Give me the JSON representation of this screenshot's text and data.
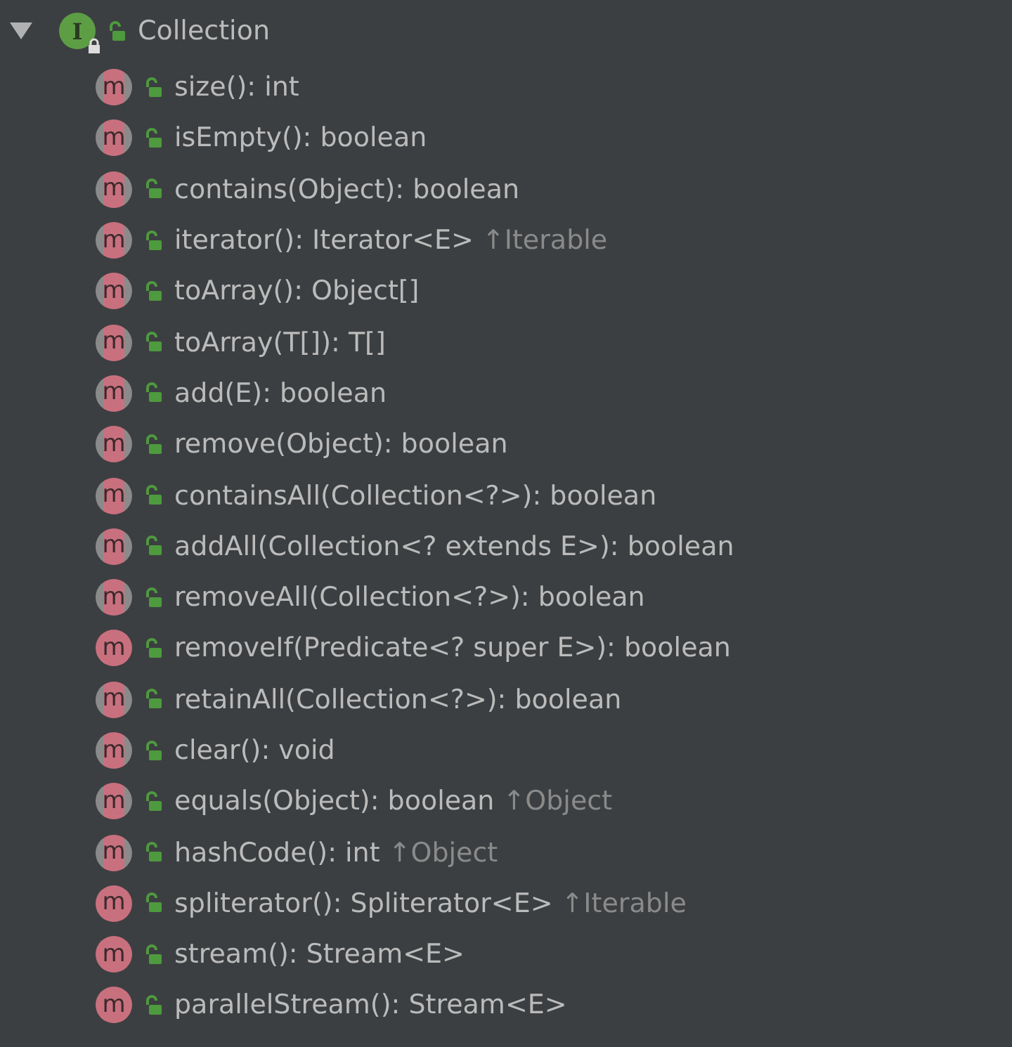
{
  "tree": {
    "label": "Collection",
    "icon": "I",
    "expanded": true,
    "children": [
      {
        "label": "size(): int",
        "icon": "m",
        "kind": "abstract"
      },
      {
        "label": "isEmpty(): boolean",
        "icon": "m",
        "kind": "abstract"
      },
      {
        "label": "contains(Object): boolean",
        "icon": "m",
        "kind": "abstract"
      },
      {
        "label": "iterator(): Iterator<E>",
        "origin": "↑Iterable",
        "icon": "m",
        "kind": "abstract"
      },
      {
        "label": "toArray(): Object[]",
        "icon": "m",
        "kind": "abstract"
      },
      {
        "label": "toArray(T[]): T[]",
        "icon": "m",
        "kind": "abstract"
      },
      {
        "label": "add(E): boolean",
        "icon": "m",
        "kind": "abstract"
      },
      {
        "label": "remove(Object): boolean",
        "icon": "m",
        "kind": "abstract"
      },
      {
        "label": "containsAll(Collection<?>): boolean",
        "icon": "m",
        "kind": "abstract"
      },
      {
        "label": "addAll(Collection<? extends E>): boolean",
        "icon": "m",
        "kind": "abstract"
      },
      {
        "label": "removeAll(Collection<?>): boolean",
        "icon": "m",
        "kind": "abstract"
      },
      {
        "label": "removeIf(Predicate<? super E>): boolean",
        "icon": "m",
        "kind": "default"
      },
      {
        "label": "retainAll(Collection<?>): boolean",
        "icon": "m",
        "kind": "abstract"
      },
      {
        "label": "clear(): void",
        "icon": "m",
        "kind": "abstract"
      },
      {
        "label": "equals(Object): boolean",
        "origin": "↑Object",
        "icon": "m",
        "kind": "abstract"
      },
      {
        "label": "hashCode(): int",
        "origin": "↑Object",
        "icon": "m",
        "kind": "abstract"
      },
      {
        "label": "spliterator(): Spliterator<E>",
        "origin": "↑Iterable",
        "icon": "m",
        "kind": "default"
      },
      {
        "label": "stream(): Stream<E>",
        "icon": "m",
        "kind": "default"
      },
      {
        "label": "parallelStream(): Stream<E>",
        "icon": "m",
        "kind": "default"
      }
    ]
  }
}
